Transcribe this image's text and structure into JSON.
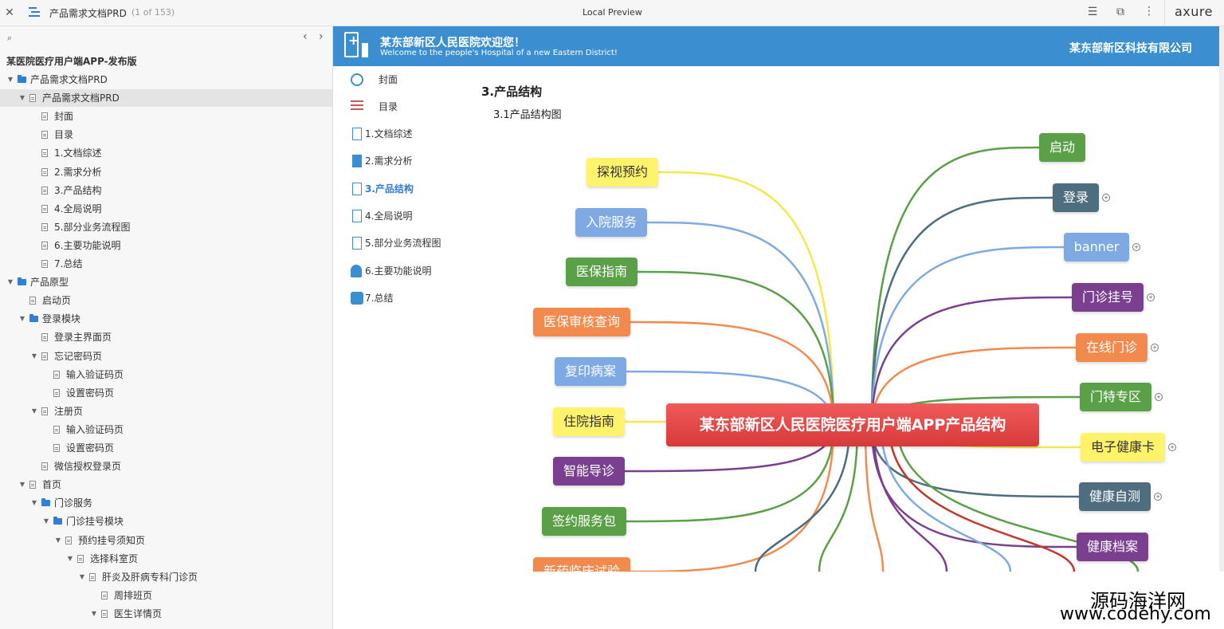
{
  "topbar": {
    "doc_title": "产品需求文档PRD",
    "page_count": "(1 of 153)",
    "center_title": "Local Preview",
    "brand": "axure"
  },
  "sidebar": {
    "project_title": "某医院医疗用户端APP-发布版",
    "tree": [
      {
        "label": "产品需求文档PRD",
        "type": "folder",
        "level": 0,
        "expanded": true
      },
      {
        "label": "产品需求文档PRD",
        "type": "page",
        "level": 1,
        "expanded": true,
        "selected": true
      },
      {
        "label": "封面",
        "type": "page",
        "level": 2
      },
      {
        "label": "目录",
        "type": "page",
        "level": 2
      },
      {
        "label": "1.文档综述",
        "type": "page",
        "level": 2
      },
      {
        "label": "2.需求分析",
        "type": "page",
        "level": 2
      },
      {
        "label": "3.产品结构",
        "type": "page",
        "level": 2
      },
      {
        "label": "4.全局说明",
        "type": "page",
        "level": 2
      },
      {
        "label": "5.部分业务流程图",
        "type": "page",
        "level": 2
      },
      {
        "label": "6.主要功能说明",
        "type": "page",
        "level": 2
      },
      {
        "label": "7.总结",
        "type": "page",
        "level": 2
      },
      {
        "label": "产品原型",
        "type": "folder",
        "level": 0,
        "expanded": true
      },
      {
        "label": "启动页",
        "type": "page",
        "level": 1
      },
      {
        "label": "登录模块",
        "type": "folder",
        "level": 1,
        "expanded": true
      },
      {
        "label": "登录主界面页",
        "type": "page",
        "level": 2
      },
      {
        "label": "忘记密码页",
        "type": "page",
        "level": 2,
        "expanded": true
      },
      {
        "label": "输入验证码页",
        "type": "page",
        "level": 3
      },
      {
        "label": "设置密码页",
        "type": "page",
        "level": 3
      },
      {
        "label": "注册页",
        "type": "page",
        "level": 2,
        "expanded": true
      },
      {
        "label": "输入验证码页",
        "type": "page",
        "level": 3
      },
      {
        "label": "设置密码页",
        "type": "page",
        "level": 3
      },
      {
        "label": "微信授权登录页",
        "type": "page",
        "level": 2
      },
      {
        "label": "首页",
        "type": "page",
        "level": 1,
        "expanded": true
      },
      {
        "label": "门诊服务",
        "type": "folder",
        "level": 2,
        "expanded": true
      },
      {
        "label": "门诊挂号模块",
        "type": "folder",
        "level": 3,
        "expanded": true
      },
      {
        "label": "预约挂号须知页",
        "type": "page",
        "level": 4,
        "expanded": true
      },
      {
        "label": "选择科室页",
        "type": "page",
        "level": 5,
        "expanded": true
      },
      {
        "label": "肝炎及肝病专科门诊页",
        "type": "page",
        "level": 6,
        "expanded": true
      },
      {
        "label": "周排班页",
        "type": "page",
        "level": 7
      },
      {
        "label": "医生详情页",
        "type": "page",
        "level": 7,
        "expanded": true
      }
    ]
  },
  "banner": {
    "title": "某东部新区人民医院欢迎您！",
    "subtitle": "Welcome to the people's Hospital of a new Eastern District!",
    "company": "某东部新区科技有限公司"
  },
  "nav": [
    {
      "label": "封面",
      "icon": "cover-icon",
      "active": false
    },
    {
      "label": "目录",
      "icon": "list-icon",
      "active": false
    },
    {
      "label": "1.文档综述",
      "icon": "document-icon",
      "active": false
    },
    {
      "label": "2.需求分析",
      "icon": "clipboard-icon",
      "active": false
    },
    {
      "label": "3.产品结构",
      "icon": "structure-icon",
      "active": true
    },
    {
      "label": "4.全局说明",
      "icon": "speaker-icon",
      "active": false
    },
    {
      "label": "5.部分业务流程图",
      "icon": "flowchart-icon",
      "active": false
    },
    {
      "label": "6.主要功能说明",
      "icon": "bell-icon",
      "active": false
    },
    {
      "label": "7.总结",
      "icon": "summary-icon",
      "active": false
    }
  ],
  "content": {
    "heading": "3.产品结构",
    "subheading": "3.1产品结构图"
  },
  "mindmap": {
    "center": "某东部新区人民医院医疗用户端APP产品结构",
    "left": [
      {
        "label": "探视预约",
        "color": "#fff36b",
        "text_color": "#333333"
      },
      {
        "label": "入院服务",
        "color": "#7fa9e3",
        "text_color": "#ffffff"
      },
      {
        "label": "医保指南",
        "color": "#5aa046",
        "text_color": "#ffffff"
      },
      {
        "label": "医保审核查询",
        "color": "#f28a4e",
        "text_color": "#ffffff"
      },
      {
        "label": "复印病案",
        "color": "#7fa9e3",
        "text_color": "#ffffff"
      },
      {
        "label": "住院指南",
        "color": "#fff36b",
        "text_color": "#333333"
      },
      {
        "label": "智能导诊",
        "color": "#7a3f8e",
        "text_color": "#ffffff"
      },
      {
        "label": "签约服务包",
        "color": "#5aa046",
        "text_color": "#ffffff"
      },
      {
        "label": "新药临床试验",
        "color": "#f28a4e",
        "text_color": "#ffffff"
      }
    ],
    "right": [
      {
        "label": "启动",
        "color": "#5aa046",
        "text_color": "#ffffff",
        "expandable": false
      },
      {
        "label": "登录",
        "color": "#4e6e80",
        "text_color": "#ffffff",
        "expandable": true
      },
      {
        "label": "banner",
        "color": "#7fa9e3",
        "text_color": "#ffffff",
        "expandable": true
      },
      {
        "label": "门诊挂号",
        "color": "#7a3f8e",
        "text_color": "#ffffff",
        "expandable": true
      },
      {
        "label": "在线门诊",
        "color": "#f28a4e",
        "text_color": "#ffffff",
        "expandable": true
      },
      {
        "label": "门特专区",
        "color": "#5aa046",
        "text_color": "#ffffff",
        "expandable": true
      },
      {
        "label": "电子健康卡",
        "color": "#fff36b",
        "text_color": "#333333",
        "expandable": true
      },
      {
        "label": "健康自测",
        "color": "#4e6e80",
        "text_color": "#ffffff",
        "expandable": true
      },
      {
        "label": "健康档案",
        "color": "#7a3f8e",
        "text_color": "#ffffff",
        "expandable": false
      }
    ]
  },
  "watermark": {
    "line1": "源码海洋网",
    "line2": "www.codehy.com"
  }
}
